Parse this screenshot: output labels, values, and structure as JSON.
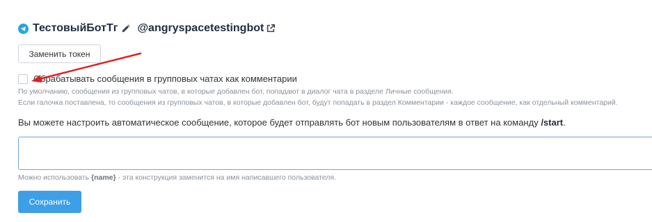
{
  "header": {
    "bot_name": "ТестовыйБотТг",
    "bot_username": "@angryspacetestingbot",
    "brand_color": "#2aa3e0"
  },
  "token_button": {
    "label": "Заменить токен"
  },
  "group_comments": {
    "checked": false,
    "label": "Обрабатывать сообщения в групповых чатах как комментарии",
    "help_line_1": "По умолчанию, сообщения из групповых чатов, в которые добавлен бот, попадают в диалог чата в разделе Личные сообщения.",
    "help_line_2": "Если галочка поставлена, то сообщения из групповых чатов, в которые добавлен бот, будут попадать в раздел Комментарии - каждое сообщение, как отдельный комментарий."
  },
  "auto_message": {
    "intro_text": "Вы можете настроить автоматическое сообщение, которое будет отправлять бот новым пользователям в ответ на команду ",
    "command": "/start",
    "intro_suffix": ".",
    "value": "",
    "hint_prefix": "Можно использовать ",
    "hint_token": "{name}",
    "hint_suffix": " - эта конструкция заменится на имя написавшего пользователя."
  },
  "save_button": {
    "label": "Сохранить",
    "color": "#3c9fe8"
  },
  "annotation": {
    "arrow_color": "#e02020"
  }
}
